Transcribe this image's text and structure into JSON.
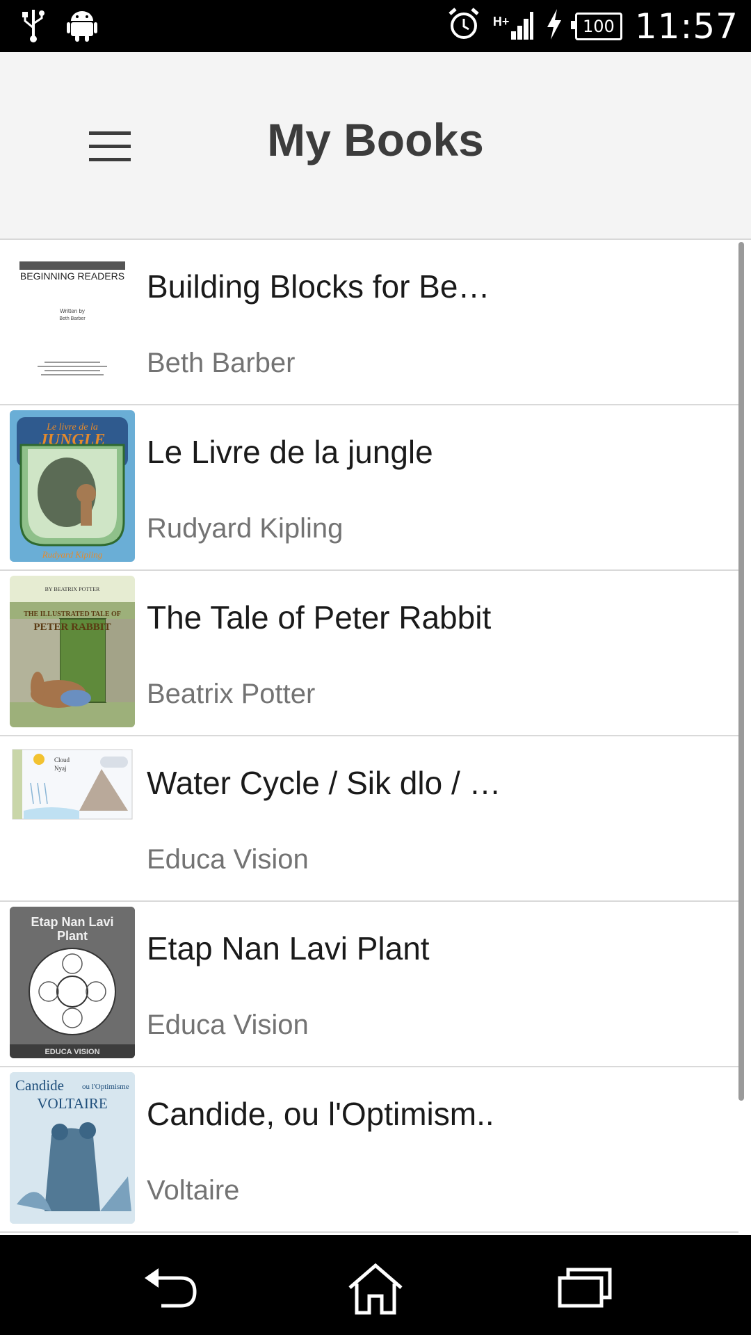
{
  "status_bar": {
    "time": "11:57",
    "battery": "100",
    "network": "H+",
    "icons": [
      "usb-icon",
      "android-icon",
      "alarm-icon",
      "signal-icon",
      "charging-icon",
      "battery-icon"
    ]
  },
  "app_bar": {
    "title": "My Books",
    "menu_icon": "hamburger-menu-icon"
  },
  "books": [
    {
      "title": "Building Blocks for Be…",
      "author": "Beth Barber"
    },
    {
      "title": "Le Livre de la jungle",
      "author": "Rudyard Kipling"
    },
    {
      "title": "The Tale of Peter Rabbit",
      "author": "Beatrix Potter"
    },
    {
      "title": "Water Cycle / Sik dlo / …",
      "author": "Educa Vision"
    },
    {
      "title": "Etap Nan Lavi Plant",
      "author": "Educa Vision"
    },
    {
      "title": "Candide, ou l'Optimism..",
      "author": "Voltaire"
    }
  ],
  "covers": {
    "building_blocks": {
      "header": "BEGINNING READERS",
      "byline": "Written by",
      "author": "Beth Barber"
    },
    "jungle": {
      "top": "Le livre de la",
      "word": "JUNGLE",
      "author": "Rudyard Kipling"
    },
    "peter_rabbit": {
      "by": "BY BEATRIX POTTER",
      "line1": "THE ILLUSTRATED TALE OF",
      "line2": "PETER RABBIT"
    },
    "water_cycle": {
      "label1": "Cloud",
      "label2": "Nyaj"
    },
    "plant": {
      "line1": "Etap Nan Lavi",
      "line2": "Plant",
      "brand": "EDUCA VISION"
    },
    "candide": {
      "line1": "Candide",
      "line1b": "ou l'Optimisme",
      "line2": "VOLTAIRE"
    }
  },
  "nav_bar": {
    "back": "back-icon",
    "home": "home-icon",
    "recents": "recent-apps-icon"
  },
  "colors": {
    "status_bar": "#000000",
    "app_bar": "#f4f4f4",
    "title_text": "#3c3c3c",
    "author_text": "#737373",
    "divider": "#d9d9d9"
  }
}
